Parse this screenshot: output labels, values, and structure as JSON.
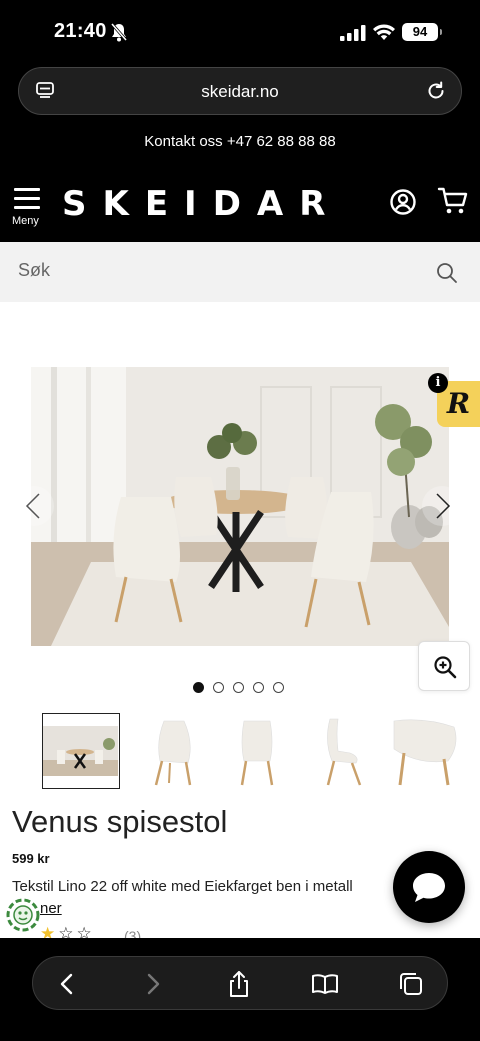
{
  "status_bar": {
    "time": "21:40",
    "battery": "94"
  },
  "browser": {
    "url": "skeidar.no"
  },
  "site": {
    "contact": "Kontakt oss +47 62 88 88 88",
    "menu_label": "Meny",
    "logo": "SKEIDAR"
  },
  "search": {
    "placeholder": "Søk"
  },
  "gallery": {
    "info_badge": "i",
    "r_badge": "R",
    "dot_count": 5,
    "active_dot": 0,
    "thumbnails": [
      "dining-set",
      "chair-front",
      "chair-back",
      "chair-side",
      "chair-detail"
    ]
  },
  "product": {
    "title": "Venus spisestol",
    "price": "599 kr",
    "description": "Tekstil Lino 22 off white med Eiekfarget ben i metall",
    "colors_link": "ner",
    "rating": 1,
    "review_count": "(3)"
  },
  "colors": {
    "rating_star": "#f2c12e",
    "badge_yellow": "#f4d15a"
  }
}
